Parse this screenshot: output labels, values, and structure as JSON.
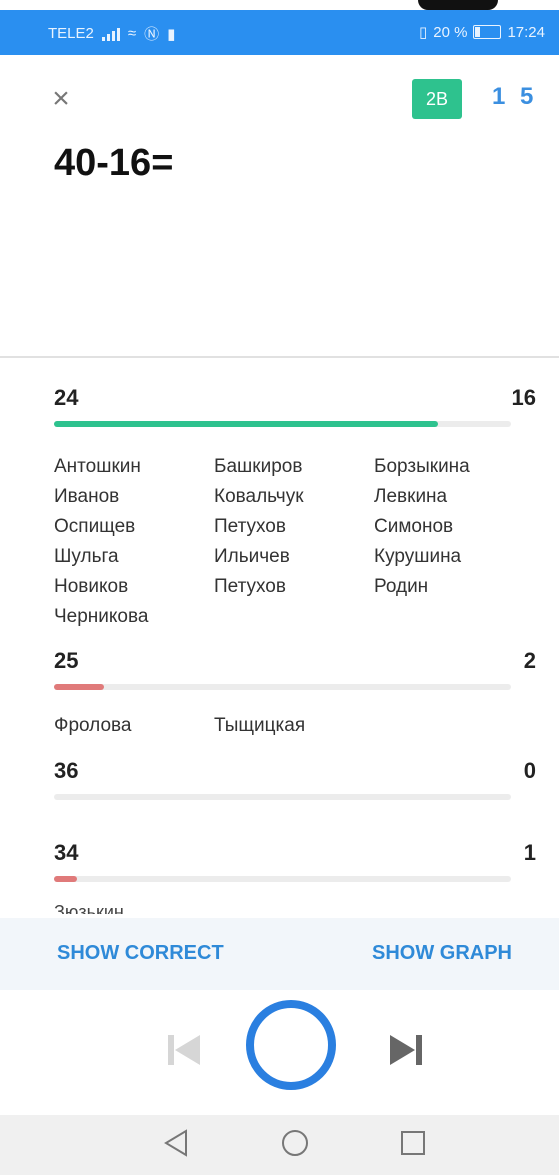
{
  "status": {
    "carrier": "TELE2",
    "battery": "20 %",
    "time": "17:24"
  },
  "header": {
    "close_icon": "close-icon",
    "class_badge": "2B",
    "counter": "1 5"
  },
  "question": "40-16=",
  "answers": [
    {
      "value": "24",
      "count": "16",
      "fill_fraction": 0.84,
      "color": "#2ec28e",
      "students": [
        "Антошкин",
        "Башкиров",
        "Борзыкина",
        "Иванов",
        "Ковальчук",
        "Левкина",
        "Оспищев",
        "Петухов",
        "Симонов",
        "Шульга",
        "Ильичев",
        "Курушина",
        "Новиков",
        "Петухов",
        "Родин",
        "Черникова"
      ]
    },
    {
      "value": "25",
      "count": "2",
      "fill_fraction": 0.11,
      "color": "#e07a7a",
      "students": [
        "Фролова",
        "Тыщицкая"
      ]
    },
    {
      "value": "36",
      "count": "0",
      "fill_fraction": 0,
      "color": "#e07a7a",
      "students": []
    },
    {
      "value": "34",
      "count": "1",
      "fill_fraction": 0.05,
      "color": "#e07a7a",
      "students": []
    }
  ],
  "cutoff_text": "Зюзькин",
  "actions": {
    "show_correct": "SHOW CORRECT",
    "show_graph": "SHOW GRAPH"
  },
  "player": {
    "prev_icon": "skip-previous-icon",
    "record_icon": "circle-ring-icon",
    "next_icon": "skip-next-icon"
  },
  "navbar": {
    "back_icon": "back-triangle-icon",
    "home_icon": "home-circle-icon",
    "recents_icon": "recents-square-icon"
  }
}
